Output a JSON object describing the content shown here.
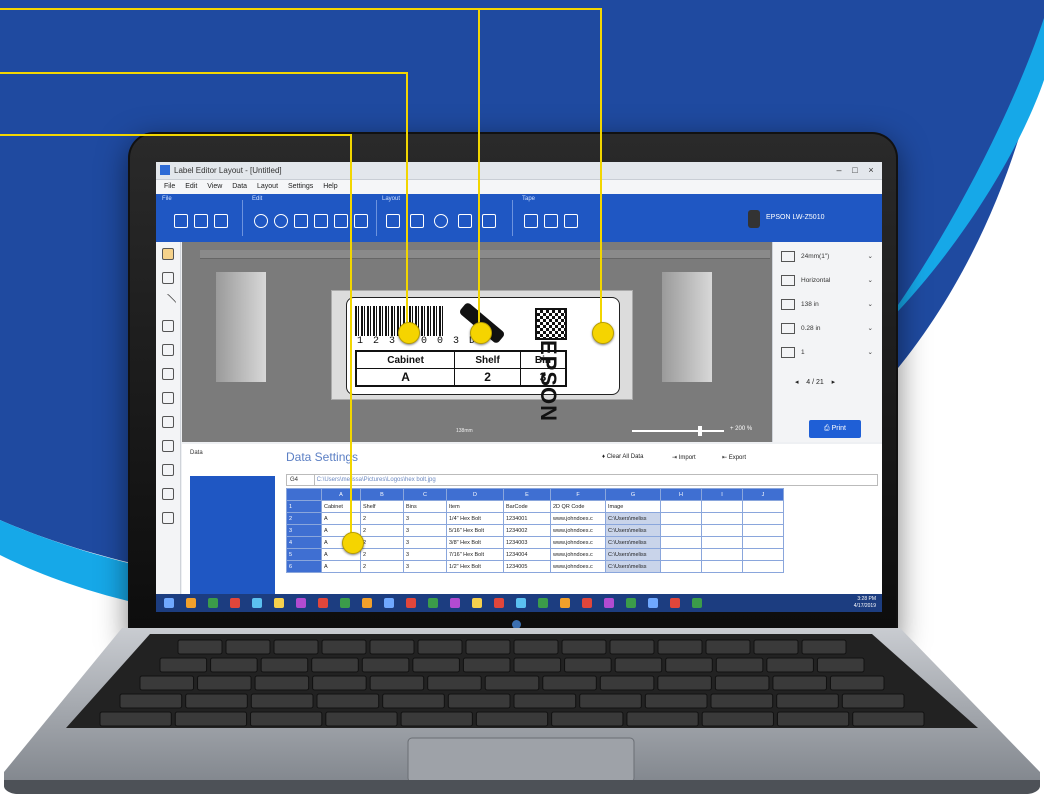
{
  "colors": {
    "background_blue": "#1f4aa0",
    "accent_cyan": "#16a8e8",
    "callout_yellow": "#f2d600",
    "ribbon_blue": "#1f57c3"
  },
  "window": {
    "title": "Label Editor Layout - [Untitled]",
    "controls": [
      "–",
      "□",
      "×"
    ]
  },
  "menu": [
    "File",
    "Edit",
    "View",
    "Data",
    "Layout",
    "Settings",
    "Help"
  ],
  "ribbon": {
    "groups": [
      "File",
      "Edit",
      "Layout",
      "Tape"
    ],
    "printer": "EPSON LW-Z5010",
    "icons": [
      "new-icon",
      "open-icon",
      "save-icon",
      "undo-icon",
      "redo-icon",
      "cut-icon",
      "copy-icon",
      "paste-icon",
      "delete-icon",
      "align-icon",
      "distribute-icon",
      "rotate-icon",
      "group-icon",
      "order-icon",
      "tape-feed-icon",
      "tape-cut-icon",
      "tape-length-icon"
    ]
  },
  "label": {
    "barcode_number": "1 2 3 4 0 0 3 D",
    "table_headers": [
      "Cabinet",
      "Shelf",
      "Bin"
    ],
    "table_values": [
      "A",
      "2",
      "3"
    ],
    "brand_text": "EPSON"
  },
  "canvas": {
    "tape_length": "138mm",
    "zoom": "+ 200 %"
  },
  "right_panel": {
    "rows": [
      {
        "icon": "tape-width-icon",
        "label": "24mm(1\")"
      },
      {
        "icon": "orientation-icon",
        "label": "Horizontal"
      },
      {
        "icon": "length-icon",
        "label": "138 in"
      },
      {
        "icon": "margin-icon",
        "label": "0.28 in"
      },
      {
        "icon": "copies-icon",
        "label": "1"
      }
    ],
    "page": "4 / 21",
    "print_label": "Print"
  },
  "data_settings": {
    "left_label": "Data",
    "title": "Data Settings",
    "actions": [
      "Clear All Data",
      "Import",
      "Export"
    ],
    "cell_ref": "G4",
    "formula_value": "C:\\Users\\melissa\\Pictures\\Logos\\hex bolt.jpg",
    "column_letters": [
      "A",
      "B",
      "C",
      "D",
      "E",
      "F",
      "G",
      "H",
      "I",
      "J"
    ],
    "headers": [
      "Cabinet",
      "Shelf",
      "Bins",
      "Item",
      "BarCode",
      "2D QR Code",
      "Image",
      "",
      "",
      ""
    ],
    "rows": [
      [
        "A",
        "2",
        "3",
        "1/4\" Hex Bolt",
        "1234001",
        "www.johndoes.c",
        "C:\\Users\\meliss",
        "",
        "",
        ""
      ],
      [
        "A",
        "2",
        "3",
        "5/16\" Hex Bolt",
        "1234002",
        "www.johndoes.c",
        "C:\\Users\\meliss",
        "",
        "",
        ""
      ],
      [
        "A",
        "2",
        "3",
        "3/8\" Hex Bolt",
        "1234003",
        "www.johndoes.c",
        "C:\\Users\\meliss",
        "",
        "",
        ""
      ],
      [
        "A",
        "2",
        "3",
        "7/16\" Hex Bolt",
        "1234004",
        "www.johndoes.c",
        "C:\\Users\\meliss",
        "",
        "",
        ""
      ],
      [
        "A",
        "2",
        "3",
        "1/2\" Hex Bolt",
        "1234005",
        "www.johndoes.c",
        "C:\\Users\\meliss",
        "",
        "",
        ""
      ]
    ]
  },
  "taskbar": {
    "time": "3:28 PM",
    "date": "4/17/2019"
  }
}
